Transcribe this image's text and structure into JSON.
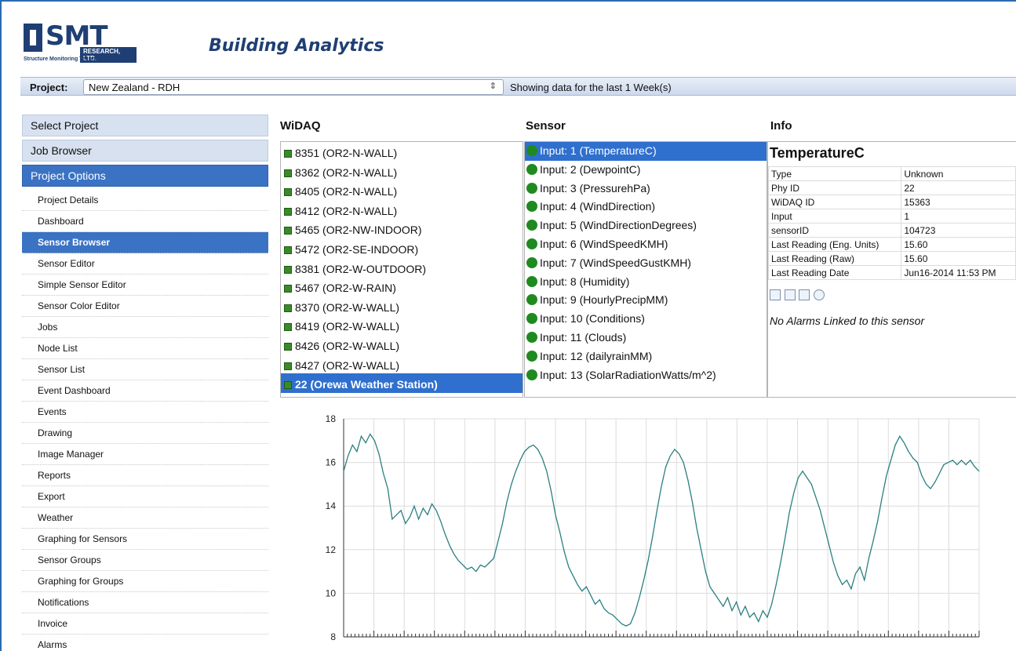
{
  "header": {
    "logo_text": "SMT",
    "logo_sub": "RESEARCH, LTD.",
    "logo_tagline": "Structure Monitoring Technology",
    "title": "Building Analytics"
  },
  "project_bar": {
    "label": "Project:",
    "selected": "New Zealand - RDH",
    "range_text": "Showing data for the last 1 Week(s)"
  },
  "sidebar": {
    "sections": [
      "Select Project",
      "Job Browser",
      "Project Options"
    ],
    "items": [
      "Project Details",
      "Dashboard",
      "Sensor Browser",
      "Sensor Editor",
      "Simple Sensor Editor",
      "Sensor Color Editor",
      "Jobs",
      "Node List",
      "Sensor List",
      "Event Dashboard",
      "Events",
      "Drawing",
      "Image Manager",
      "Reports",
      "Export",
      "Weather",
      "Graphing for Sensors",
      "Sensor Groups",
      "Graphing for Groups",
      "Notifications",
      "Invoice",
      "Alarms"
    ],
    "selected_item": "Sensor Browser"
  },
  "widaq": {
    "title": "WiDAQ",
    "rows": [
      "8351 (OR2-N-WALL)",
      "8362 (OR2-N-WALL)",
      "8405 (OR2-N-WALL)",
      "8412 (OR2-N-WALL)",
      "5465 (OR2-NW-INDOOR)",
      "5472 (OR2-SE-INDOOR)",
      "8381 (OR2-W-OUTDOOR)",
      "5467 (OR2-W-RAIN)",
      "8370 (OR2-W-WALL)",
      "8419 (OR2-W-WALL)",
      "8426 (OR2-W-WALL)",
      "8427 (OR2-W-WALL)",
      "22 (Orewa Weather Station)"
    ],
    "selected": "22 (Orewa Weather Station)"
  },
  "sensor": {
    "title": "Sensor",
    "rows": [
      "Input: 1 (TemperatureC)",
      "Input: 2 (DewpointC)",
      "Input: 3 (PressurehPa)",
      "Input: 4 (WindDirection)",
      "Input: 5 (WindDirectionDegrees)",
      "Input: 6 (WindSpeedKMH)",
      "Input: 7 (WindSpeedGustKMH)",
      "Input: 8 (Humidity)",
      "Input: 9 (HourlyPrecipMM)",
      "Input: 10 (Conditions)",
      "Input: 11 (Clouds)",
      "Input: 12 (dailyrainMM)",
      "Input: 13 (SolarRadiationWatts/m^2)"
    ],
    "selected": "Input: 1 (TemperatureC)"
  },
  "info": {
    "title": "Info",
    "sensor_name": "TemperatureC",
    "rows": [
      {
        "k": "Type",
        "v": "Unknown"
      },
      {
        "k": "Phy ID",
        "v": "22"
      },
      {
        "k": "WiDAQ ID",
        "v": "15363"
      },
      {
        "k": "Input",
        "v": "1"
      },
      {
        "k": "sensorID",
        "v": "104723"
      },
      {
        "k": "Last Reading (Eng. Units)",
        "v": "15.60"
      },
      {
        "k": "Last Reading (Raw)",
        "v": "15.60"
      },
      {
        "k": "Last Reading Date",
        "v": "Jun16-2014 11:53 PM"
      }
    ],
    "no_alarms": "No Alarms Linked to this sensor"
  },
  "chart_data": {
    "type": "line",
    "title": "",
    "xlabel": "",
    "ylabel": "",
    "ylim": [
      8,
      18
    ],
    "yticks": [
      8,
      10,
      12,
      14,
      16,
      18
    ],
    "grid": true,
    "line_color": "#2a7f7f",
    "series": [
      {
        "values": [
          15.6,
          16.3,
          16.8,
          16.5,
          17.2,
          16.9,
          17.3,
          17.0,
          16.4,
          15.5,
          14.8,
          13.4,
          13.6,
          13.8,
          13.2,
          13.5,
          14.0,
          13.4,
          13.9,
          13.6,
          14.1,
          13.8,
          13.3,
          12.7,
          12.2,
          11.8,
          11.5,
          11.3,
          11.1,
          11.2,
          11.0,
          11.3,
          11.2,
          11.4,
          11.6,
          12.4,
          13.2,
          14.2,
          15.0,
          15.6,
          16.1,
          16.5,
          16.7,
          16.8,
          16.6,
          16.2,
          15.6,
          14.7,
          13.6,
          12.8,
          11.9,
          11.2,
          10.8,
          10.4,
          10.1,
          10.3,
          9.9,
          9.5,
          9.7,
          9.3,
          9.1,
          9.0,
          8.8,
          8.6,
          8.5,
          8.6,
          9.1,
          9.8,
          10.6,
          11.5,
          12.6,
          13.8,
          14.9,
          15.8,
          16.3,
          16.6,
          16.4,
          16.0,
          15.2,
          14.2,
          13.0,
          12.0,
          11.0,
          10.3,
          10.0,
          9.7,
          9.4,
          9.8,
          9.2,
          9.6,
          9.0,
          9.4,
          8.9,
          9.1,
          8.7,
          9.2,
          8.9,
          9.5,
          10.4,
          11.4,
          12.5,
          13.7,
          14.6,
          15.3,
          15.6,
          15.3,
          15.0,
          14.4,
          13.8,
          13.0,
          12.2,
          11.4,
          10.8,
          10.4,
          10.6,
          10.2,
          10.9,
          11.2,
          10.6,
          11.6,
          12.4,
          13.3,
          14.4,
          15.4,
          16.1,
          16.8,
          17.2,
          16.9,
          16.5,
          16.2,
          16.0,
          15.4,
          15.0,
          14.8,
          15.1,
          15.5,
          15.9,
          16.0,
          16.1,
          15.9,
          16.1,
          15.9,
          16.1,
          15.8,
          15.6
        ]
      }
    ]
  }
}
